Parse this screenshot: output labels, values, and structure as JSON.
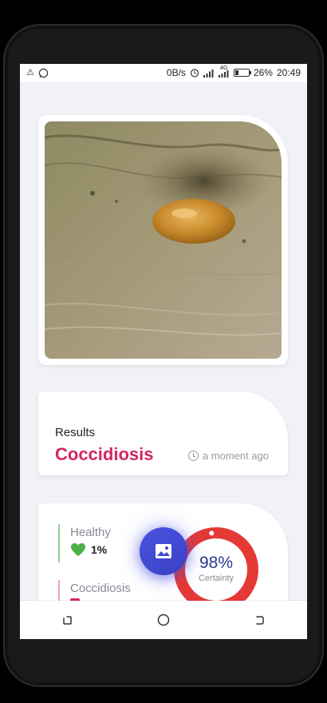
{
  "status_bar": {
    "left_icons": [
      "warning-icon",
      "whatsapp-icon"
    ],
    "network_speed": "0B/s",
    "network_type": "4G",
    "battery": "26%",
    "battery_level": 0.26,
    "time": "20:49"
  },
  "results": {
    "label": "Results",
    "disease": "Coccidiosis",
    "time_ago": "a moment ago"
  },
  "stats": [
    {
      "name": "Healthy",
      "value": "1%",
      "icon": "heart-icon",
      "color": "#4cb04a"
    },
    {
      "name": "Coccidiosis",
      "value": "",
      "icon": "square-icon",
      "color": "#d3265f"
    }
  ],
  "gauge": {
    "value": "98%",
    "label": "Certainty",
    "fraction": 0.98,
    "color": "#e53935"
  },
  "fab": {
    "icon": "image-icon"
  },
  "nav": {
    "buttons": [
      "recent-apps-icon",
      "home-icon",
      "back-icon"
    ]
  },
  "colors": {
    "accent": "#d3265f",
    "primary": "#3f47d1",
    "background": "#f1f2f7"
  }
}
